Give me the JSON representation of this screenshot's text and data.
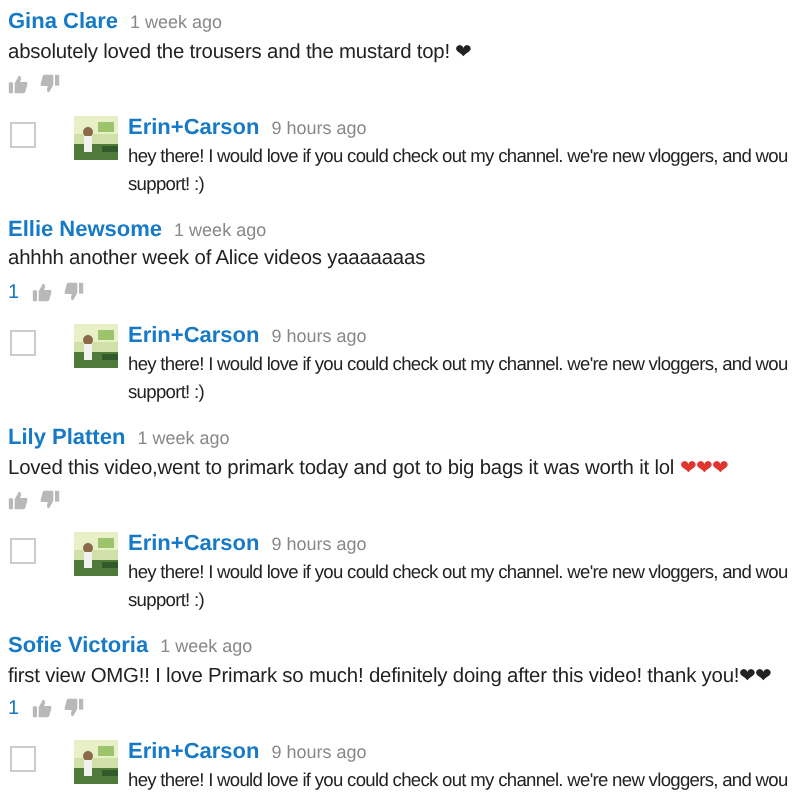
{
  "comments": [
    {
      "author": "Gina Clare",
      "time": "1 week ago",
      "text": "absolutely loved the trousers and the mustard top! ❤",
      "reply": {
        "checked": false,
        "author": "Erin+Carson",
        "time": "9 hours ago",
        "lines": [
          "hey there! I would love if you could check out my channel. we're new vloggers, and wou",
          "support! :)"
        ]
      }
    },
    {
      "author": "Ellie Newsome",
      "time": "1 week ago",
      "text": "ahhhh another week of Alice videos yaaaaaaas",
      "likes": "1",
      "reply": {
        "checked": false,
        "author": "Erin+Carson",
        "time": "9 hours ago",
        "lines": [
          "hey there! I would love if you could check out my channel. we're new vloggers, and wou",
          "support! :)"
        ]
      }
    },
    {
      "author": "Lily Platten",
      "time": "1 week ago",
      "text": "Loved this video,went to primark today and got to big bags it was worth it lol",
      "emoji": {
        "text": "❤❤❤",
        "color": "#e0342f"
      },
      "reply": {
        "checked": false,
        "author": "Erin+Carson",
        "time": "9 hours ago",
        "lines": [
          "hey there! I would love if you could check out my channel. we're new vloggers, and wou",
          "support! :)"
        ]
      }
    },
    {
      "author": "Sofie Victoria",
      "time": "1 week ago",
      "text": "first view OMG!! I love Primark so much! definitely doing after this video! thank you!❤❤",
      "likes": "1",
      "reply": {
        "checked": false,
        "author": "Erin+Carson",
        "time": "9 hours ago",
        "lines": [
          "hey there! I would love if you could check out my channel. we're new vloggers, and wou"
        ]
      }
    }
  ]
}
